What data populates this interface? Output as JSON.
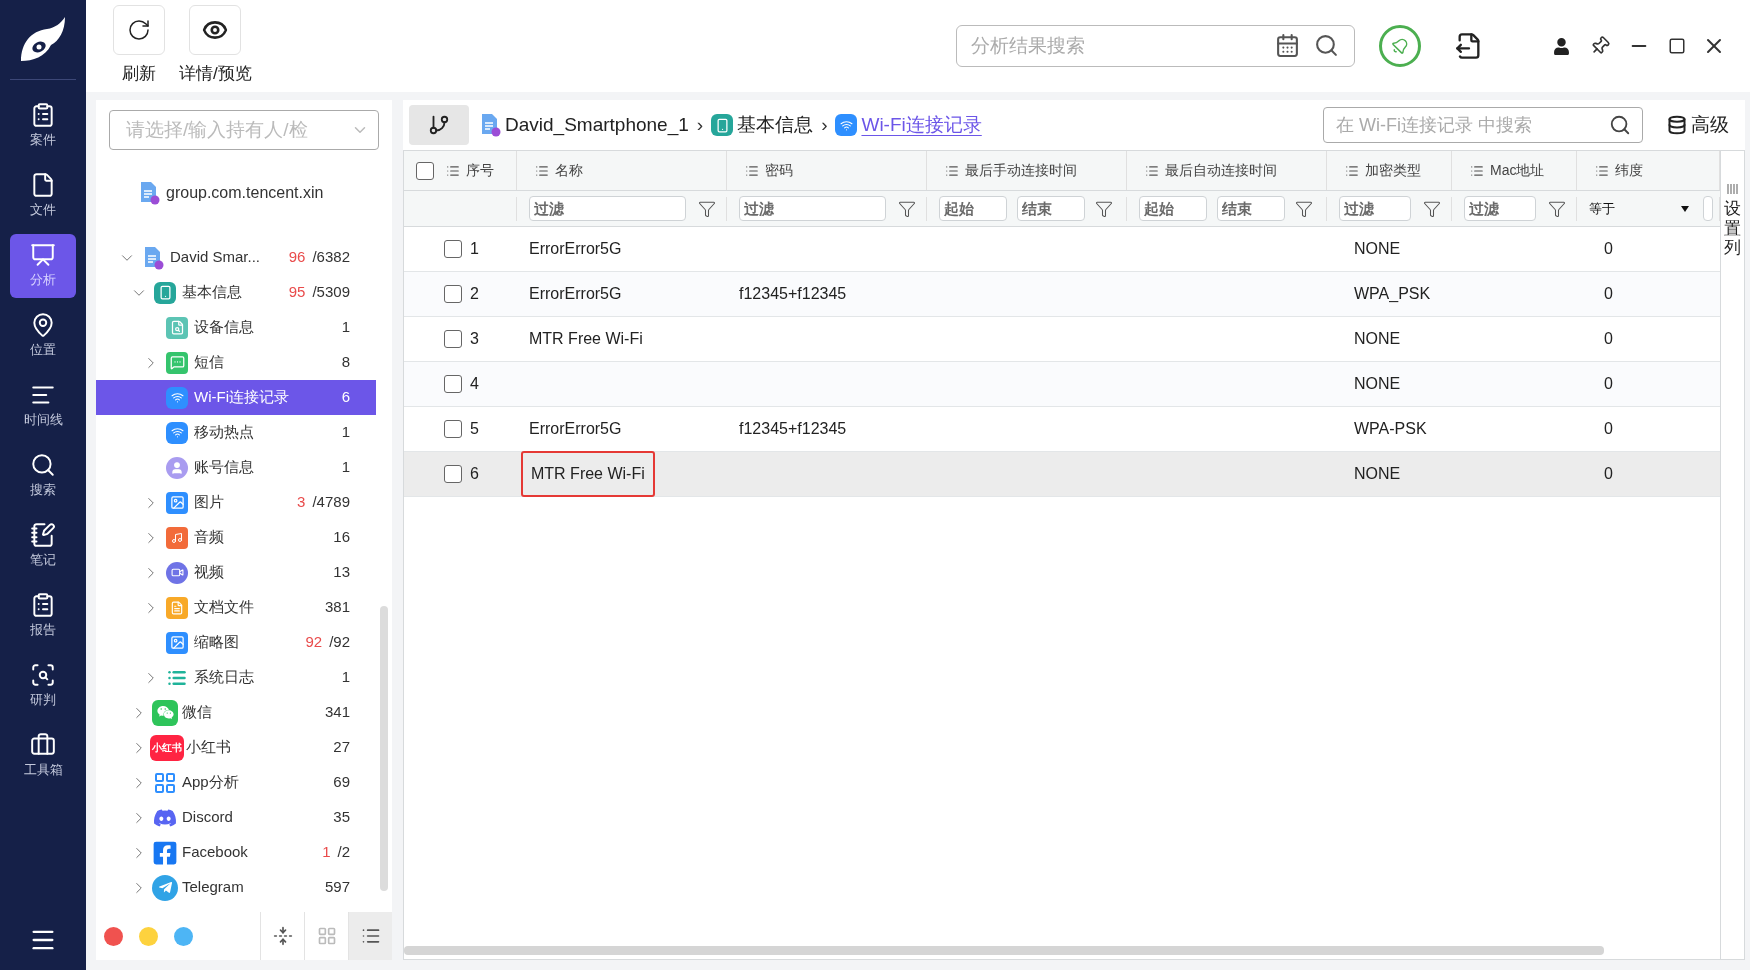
{
  "nav": {
    "items": [
      {
        "label": "案件",
        "selected": false
      },
      {
        "label": "文件",
        "selected": false
      },
      {
        "label": "分析",
        "selected": true
      },
      {
        "label": "位置",
        "selected": false
      },
      {
        "label": "时间线",
        "selected": false
      },
      {
        "label": "搜索",
        "selected": false
      },
      {
        "label": "笔记",
        "selected": false
      },
      {
        "label": "报告",
        "selected": false
      },
      {
        "label": "研判",
        "selected": false
      },
      {
        "label": "工具箱",
        "selected": false
      }
    ]
  },
  "toolbar": {
    "buttons": [
      {
        "label": "刷新"
      },
      {
        "label": "详情/预览"
      }
    ]
  },
  "global_search": {
    "placeholder": "分析结果搜索"
  },
  "holder_select": {
    "placeholder": "请选择/输入持有人/检"
  },
  "pinned_item": {
    "label": "group.com.tencent.xin",
    "kind": "file"
  },
  "tree": [
    {
      "label": "David Smar...",
      "kind": "file",
      "flagged": "96",
      "count": "/6382",
      "expanded": true,
      "selected": false,
      "children": [
        {
          "label": "基本信息",
          "kind": "phone-info",
          "flagged": "95",
          "count": "/5309",
          "expanded": true,
          "selected": false,
          "children": [
            {
              "label": "设备信息",
              "kind": "device-info",
              "count": "1",
              "selected": false
            },
            {
              "label": "短信",
              "kind": "sms",
              "count": "8",
              "expanded": false,
              "selected": false
            },
            {
              "label": "Wi-Fi连接记录",
              "kind": "wifi",
              "count": "6",
              "selected": true
            },
            {
              "label": "移动热点",
              "kind": "wifi",
              "count": "1",
              "selected": false
            },
            {
              "label": "账号信息",
              "kind": "account",
              "count": "1",
              "selected": false
            },
            {
              "label": "图片",
              "kind": "image",
              "flagged": "3",
              "count": "/4789",
              "expanded": false,
              "selected": false
            },
            {
              "label": "音频",
              "kind": "audio",
              "count": "16",
              "expanded": false,
              "selected": false
            },
            {
              "label": "视频",
              "kind": "video",
              "count": "13",
              "expanded": false,
              "selected": false
            },
            {
              "label": "文档文件",
              "kind": "document",
              "count": "381",
              "expanded": false,
              "selected": false
            },
            {
              "label": "缩略图",
              "kind": "image",
              "flagged": "92",
              "count": "/92",
              "selected": false
            },
            {
              "label": "系统日志",
              "kind": "syslog",
              "count": "1",
              "expanded": false,
              "selected": false
            }
          ]
        },
        {
          "label": "微信",
          "kind": "wechat",
          "count": "341",
          "expanded": false,
          "selected": false
        },
        {
          "label": "小红书",
          "kind": "xiaohongshu",
          "icon_text": "小红书",
          "count": "27",
          "expanded": false,
          "selected": false
        },
        {
          "label": "App分析",
          "kind": "apps",
          "count": "69",
          "expanded": false,
          "selected": false
        },
        {
          "label": "Discord",
          "kind": "discord",
          "count": "35",
          "expanded": false,
          "selected": false
        },
        {
          "label": "Facebook",
          "kind": "facebook",
          "flagged": "1",
          "count": "/2",
          "expanded": false,
          "selected": false
        },
        {
          "label": "Telegram",
          "kind": "telegram",
          "count": "597",
          "expanded": false,
          "selected": false
        }
      ]
    }
  ],
  "color_tags": [
    {
      "color": "#f0524f"
    },
    {
      "color": "#fdd23e"
    },
    {
      "color": "#4db5f5"
    }
  ],
  "view_buttons": [
    {
      "selected": false
    },
    {
      "selected": false
    },
    {
      "selected": true
    }
  ],
  "breadcrumb": {
    "separator": "›",
    "items": [
      {
        "label": "David_Smartphone_1",
        "kind": "file",
        "current": false
      },
      {
        "label": "基本信息",
        "kind": "phone-info",
        "current": false
      },
      {
        "label": "Wi-Fi连接记录",
        "kind": "wifi",
        "current": true
      }
    ]
  },
  "table_search": {
    "placeholder": "在 Wi-Fi连接记录 中搜索"
  },
  "advanced_button": "高级",
  "table": {
    "select_all": {
      "checked": false
    },
    "columns": [
      {
        "label": "序号"
      },
      {
        "label": "名称",
        "filter": {
          "kind": "text",
          "placeholder": "过滤"
        }
      },
      {
        "label": "密码",
        "filter": {
          "kind": "text",
          "placeholder": "过滤"
        }
      },
      {
        "label": "最后手动连接时间",
        "filter": {
          "kind": "range",
          "from_placeholder": "起始",
          "to_placeholder": "结束"
        }
      },
      {
        "label": "最后自动连接时间",
        "filter": {
          "kind": "range",
          "from_placeholder": "起始",
          "to_placeholder": "结束"
        }
      },
      {
        "label": "加密类型",
        "filter": {
          "kind": "text",
          "placeholder": "过滤"
        }
      },
      {
        "label": "Mac地址",
        "filter": {
          "kind": "text",
          "placeholder": "过滤"
        }
      },
      {
        "label": "纬度",
        "filter": {
          "kind": "select",
          "value": "等于"
        }
      }
    ],
    "rows": [
      {
        "checked": false,
        "selected": false,
        "outlined": false,
        "cells": [
          "1",
          "ErrorError5G",
          "",
          "",
          "",
          "NONE",
          "",
          "0"
        ]
      },
      {
        "checked": false,
        "selected": false,
        "outlined": false,
        "cells": [
          "2",
          "ErrorError5G",
          "f12345+f12345",
          "",
          "",
          "WPA_PSK",
          "",
          "0"
        ]
      },
      {
        "checked": false,
        "selected": false,
        "outlined": false,
        "cells": [
          "3",
          "MTR Free Wi-Fi",
          "",
          "",
          "",
          "NONE",
          "",
          "0"
        ]
      },
      {
        "checked": false,
        "selected": false,
        "outlined": false,
        "cells": [
          "4",
          "",
          "",
          "",
          "",
          "NONE",
          "",
          "0"
        ]
      },
      {
        "checked": false,
        "selected": false,
        "outlined": false,
        "cells": [
          "5",
          "ErrorError5G",
          "f12345+f12345",
          "",
          "",
          "WPA-PSK",
          "",
          "0"
        ]
      },
      {
        "checked": false,
        "selected": true,
        "outlined": true,
        "cells": [
          "6",
          "MTR Free Wi-Fi",
          "",
          "",
          "",
          "NONE",
          "",
          "0"
        ]
      }
    ]
  },
  "column_settings": "设置列"
}
